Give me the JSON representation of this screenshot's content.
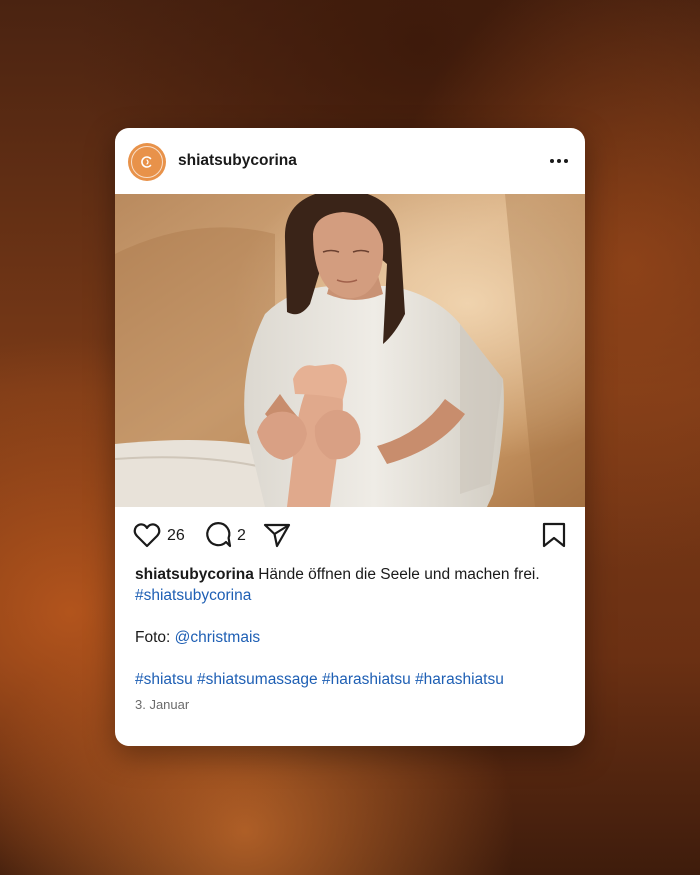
{
  "post": {
    "username": "shiatsubycorina",
    "avatar_color": "#e8924a",
    "more_icon": "more-horizontal-icon",
    "likes": "26",
    "comments": "2",
    "caption": {
      "username": "shiatsubycorina",
      "text": "Hände öffnen die Seele und machen frei.",
      "hashtag_inline": "#shiatsubycorina",
      "photo_label": "Foto:",
      "photo_credit": "@christmais",
      "hashtags": [
        "#shiatsu",
        "#shiatsumassage",
        "#harashiatsu",
        "#harashiatsu"
      ]
    },
    "date": "3. Januar",
    "link_color": "#1e5fb4"
  }
}
